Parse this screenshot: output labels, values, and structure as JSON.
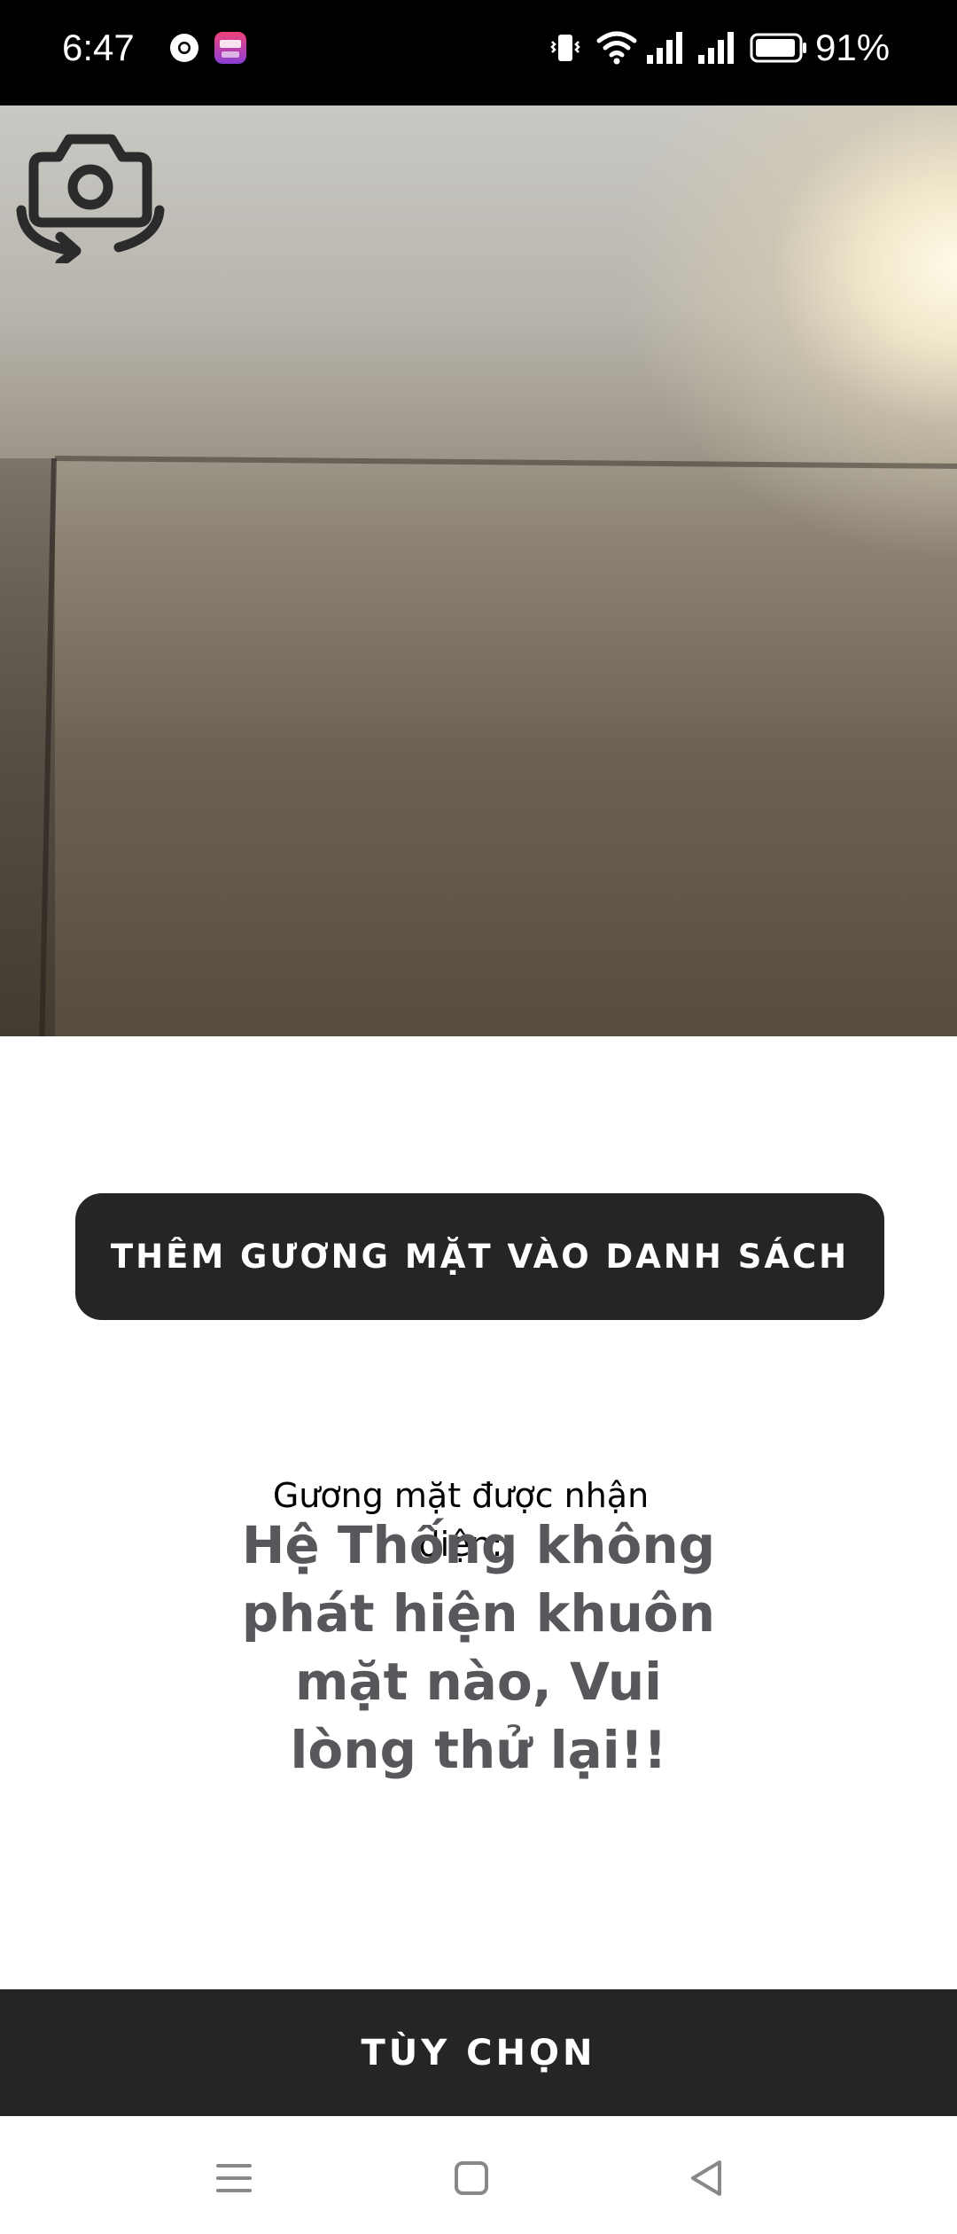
{
  "status_bar": {
    "time": "6:47",
    "battery_percent": "91%",
    "icons": [
      "chrome-icon",
      "promo-app-icon",
      "vibrate-icon",
      "wifi-icon",
      "signal-icon",
      "signal-icon",
      "battery-icon"
    ]
  },
  "camera": {
    "switch_camera_icon": "camera-switch-icon"
  },
  "actions": {
    "add_face_label": "THÊM GƯƠNG MẶT VÀO DANH SÁCH",
    "options_label": "TÙY CHỌN"
  },
  "result": {
    "recognized_label": "Gương mặt được nhận diện:",
    "message": "Hệ Thống không phát hiện khuôn mặt nào, Vui lòng thử lại!!"
  },
  "nav_bar": {
    "icons": [
      "menu-icon",
      "home-icon",
      "back-icon"
    ]
  },
  "colors": {
    "button_bg": "#252528",
    "message_text": "#58585c"
  }
}
